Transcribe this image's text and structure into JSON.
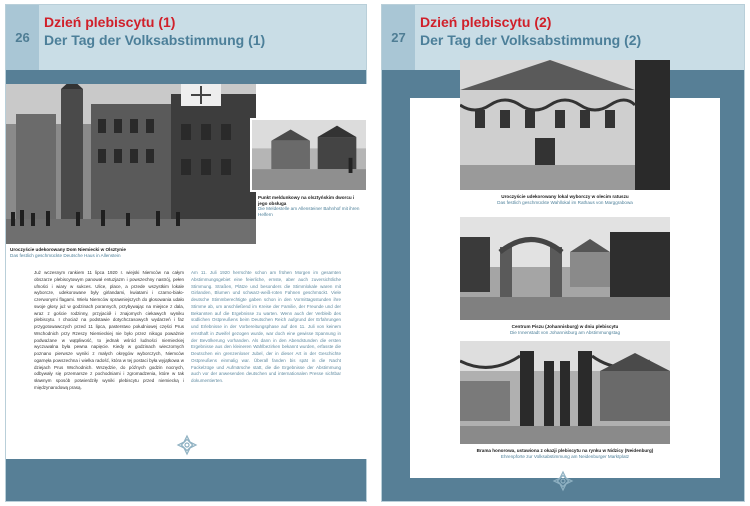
{
  "left_page": {
    "page_number": "26",
    "title_pl": "Dzień plebiscytu (1)",
    "title_de": "Der Tag der Volksabstimmung (1)",
    "photo_main_caption_pl": "Uroczyście udekorowany Dom Niemiecki w Olsztynie",
    "photo_main_caption_de": "Das festlich geschmückte Deutsche Haus in Allenstein",
    "photo_small_caption_pl": "Punkt meldunkowy na olsztyńskim dworcu i jego obsługa",
    "photo_small_caption_de": "Die Meldestelle am Allensteiner Bahnhof mit ihren Helfern",
    "text_pl": "Już wczesnym rankiem 11 lipca 1920 r. wiejski Niemców na całym obszarze plebiscytowym panował entuzjazm i powszechny nastrój, pełen ufności i wiary w sukces. Ulice, place, a przede wszystkim lokale wyborcze, udekorowane były girlandami, kwiatami i czarno-biało-czerwonymi flagami. Wielu Niemców sprawniejszych do głosowania udało swoje głosy już w godzinach porannych, przybywając na miejsce z dala, wraz z goście rodzinny, przyjaciół i znajomych ciekawych wyniku plebiscytu. I chociaż na podstawie dotychczasowych wydarzeń i faz przygotowawczych przed 11 lipca, pasterstwo południowej części Prus Wschodnich przy Rzeszy Niemieckiej nie było przez nikogo poważnie podważane w wątpliwość, to jednak wśród ludności niemieckiej wyczuwalna była pewna napięcie. Kiedy w godzinach wieczornych poznano pierwsze wyniki z małych okręgów wyborczych, Niemców ogarnęła powszechna i wielka radość, która w tej postaci była wyjątkowa w dziejach Prus Wschodnich. Wszędzie, do późnych godzin nocnych, odbywały się przemarsze z pochodniami i zgromadzenia, które w tak sławnym sposób potwierdziły wyniki plebiscytu przed niemiecką i międzynarodową prasą.",
    "text_de": "Am 11. Juli 1920 herrschte schon am frühen Morgen im gesamten Abstimmungsgebiet eine feierliche, ernste, aber auch zuversichtliche Stimmung. Straßen, Plätze und besonders die Stimmlokale waren mit Girlanden, Blumen und schwarz-weiß-roten Fahnen geschmückt. Viele deutsche Stimmberechtigte gaben schon in den Vormittagsstunden ihre Stimme ab, um anschließend im Kreise der Familie, der Freunde und der Bekannten auf die Ergebnisse zu warten. Wenn auch der Verbleib des südlichen Ostpreußens beim Deutschen Reich aufgrund der Erfahrungen und Erlebnisse in der Vorbereitungsphase auf den 11. Juli von keinem ernsthaft in Zweifel gezogen wurde, war doch eine gewisse Spannung in der Bevölkerung vorhanden. Als dann in den Abendstunden die ersten Ergebnisse aus den kleineren Wahlbezirken bekannt wurden, erfasste die Deutschen ein grenzenloser Jubel, der in dieser Art in der Geschichte Ostpreußens einmalig war. Überall fanden bis spät in die Nacht Fackelzüge und Aufmärsche statt, die die Ergebnisse der Abstimmung auch vor der anwesenden deutschen und internationalen Presse sichtbar dokumentierten."
  },
  "right_page": {
    "page_number": "27",
    "title_pl": "Dzień plebiscytu (2)",
    "title_de": "Der Tag der Volksabstimmung (2)",
    "photo1_caption_pl": "Uroczyście udekorowany lokal wyborczy w olecim ratuszu",
    "photo1_caption_de": "Das festlich geschmückte Wahllokal im Rathaus von Marggrabowa",
    "photo2_caption_pl": "Centrum Piszu (Johannisburg) w dniu plebiscytu",
    "photo2_caption_de": "Die Innenstadt von Johannisburg am Abstimmungstag",
    "photo3_caption_pl": "Brama honorowa, ustawiona z okazji plebiscytu na rynku w Nidzicy (Neidenburg)",
    "photo3_caption_de": "Ehrenpforte zur Volksabstimmung am Neidenburger Marktplatz"
  },
  "colors": {
    "accent_red": "#d0202a",
    "accent_blue": "#4c7f99",
    "band": "#577f96",
    "page_bg": "#c9dde6"
  },
  "icons": [
    "ornament-icon"
  ]
}
